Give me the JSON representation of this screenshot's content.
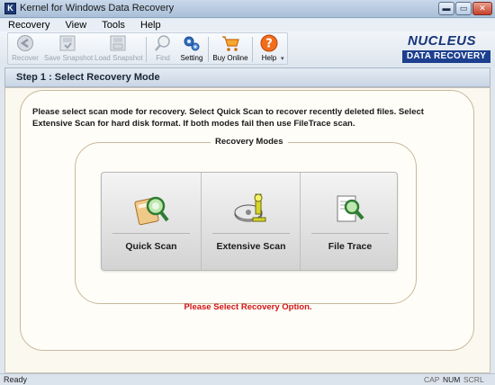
{
  "window": {
    "title": "Kernel for Windows Data Recovery",
    "app_icon_letter": "K",
    "minimize_glyph": "▬",
    "maximize_glyph": "▭",
    "close_glyph": "✕"
  },
  "menu": [
    "Recovery",
    "View",
    "Tools",
    "Help"
  ],
  "toolbar": {
    "items": [
      {
        "label": "Recover",
        "icon": "recover-icon",
        "enabled": false
      },
      {
        "label": "Save Snapshot",
        "icon": "save-snapshot-icon",
        "enabled": false
      },
      {
        "label": "Load Snapshot",
        "icon": "load-snapshot-icon",
        "enabled": false
      },
      {
        "label": "Find",
        "icon": "find-icon",
        "enabled": false
      },
      {
        "label": "Setting",
        "icon": "gear-icon",
        "enabled": true
      },
      {
        "label": "Buy Online",
        "icon": "cart-icon",
        "enabled": true
      },
      {
        "label": "Help",
        "icon": "help-icon",
        "enabled": true
      }
    ]
  },
  "logo": {
    "line1": "NUCLEUS",
    "line2": "DATA RECOVERY"
  },
  "step": {
    "title": "Step 1 : Select Recovery Mode"
  },
  "description": "Please select scan mode for recovery. Select Quick Scan to recover recently deleted files. Select Extensive Scan for hard disk format. If both modes fail then use FileTrace scan.",
  "modes": {
    "legend": "Recovery Modes",
    "items": [
      {
        "label": "Quick Scan",
        "icon": "quick-scan-icon"
      },
      {
        "label": "Extensive Scan",
        "icon": "extensive-scan-icon"
      },
      {
        "label": "File Trace",
        "icon": "file-trace-icon"
      }
    ]
  },
  "prompt": "Please Select Recovery Option.",
  "status": {
    "ready": "Ready",
    "cap": "CAP",
    "num": "NUM",
    "scrl": "SCRL"
  },
  "colors": {
    "accent": "#1c3f8f",
    "warning": "#d21414"
  }
}
